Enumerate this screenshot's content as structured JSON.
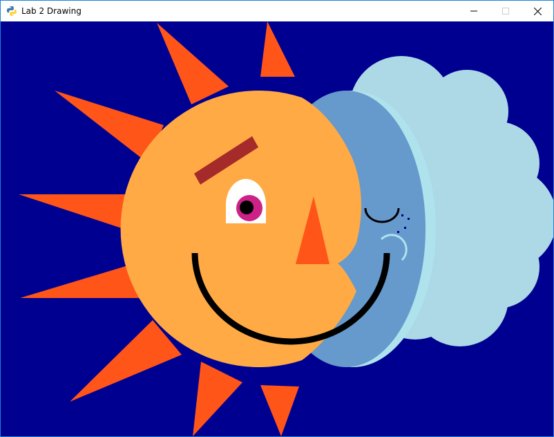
{
  "window": {
    "title": "Lab 2 Drawing",
    "app_icon": "python-icon",
    "controls": [
      "minimize-icon",
      "maximize-icon",
      "close-icon"
    ]
  },
  "drawing": {
    "background_color": "#000090",
    "sun_color": "#FFAA44",
    "ray_color": "#FF5518",
    "moon_color": "#6699CC",
    "moon_rim_color": "#AEE2EC",
    "cloud_color": "#ADD8E6",
    "eyebrow_color": "#A52A2A",
    "iris_color": "#CC2288",
    "nose_color": "#FF5518",
    "smile_color": "#000000"
  }
}
